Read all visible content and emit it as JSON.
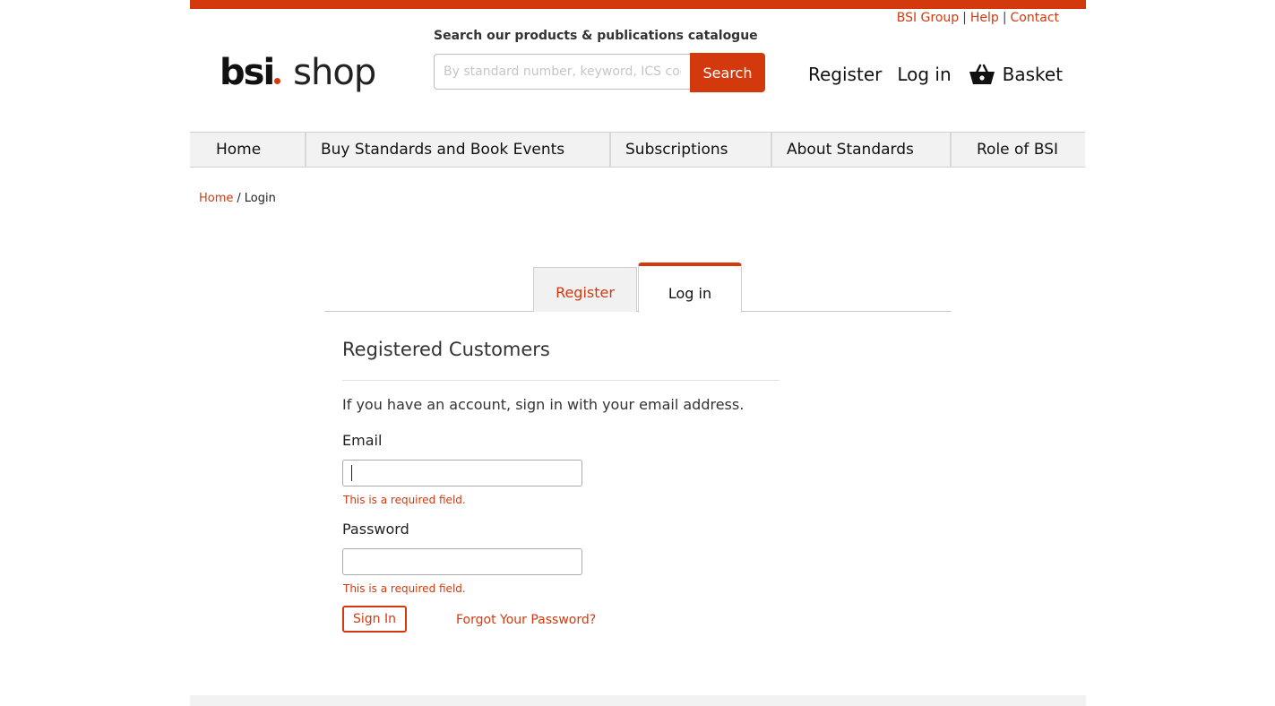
{
  "header": {
    "util_links": [
      "BSI Group",
      "Help",
      "Contact"
    ],
    "logo_primary": "bsi",
    "logo_secondary": "shop",
    "search_label": "Search our products & publications catalogue",
    "search_placeholder": "By standard number, keyword, ICS code, ISBN",
    "search_button": "Search",
    "register": "Register",
    "login": "Log in",
    "basket": "Basket"
  },
  "nav": {
    "items": [
      "Home",
      "Buy Standards and Book Events",
      "Subscriptions",
      "About Standards",
      "Role of BSI"
    ]
  },
  "breadcrumb": {
    "home": "Home",
    "separator": "/",
    "current": "Login"
  },
  "tabs": {
    "register": "Register",
    "login": "Log in",
    "active": "Log in"
  },
  "login_form": {
    "title": "Registered Customers",
    "intro": "If you have an account, sign in with your email address.",
    "email_label": "Email",
    "email_value": "",
    "email_error": "This is a required field.",
    "password_label": "Password",
    "password_value": "",
    "password_error": "This is a required field.",
    "signin_button": "Sign In",
    "forgot_link": "Forgot Your Password?"
  },
  "colors": {
    "accent": "#d4390e",
    "nav_bg": "#f2f2f2"
  },
  "icons": [
    "basket-icon"
  ]
}
